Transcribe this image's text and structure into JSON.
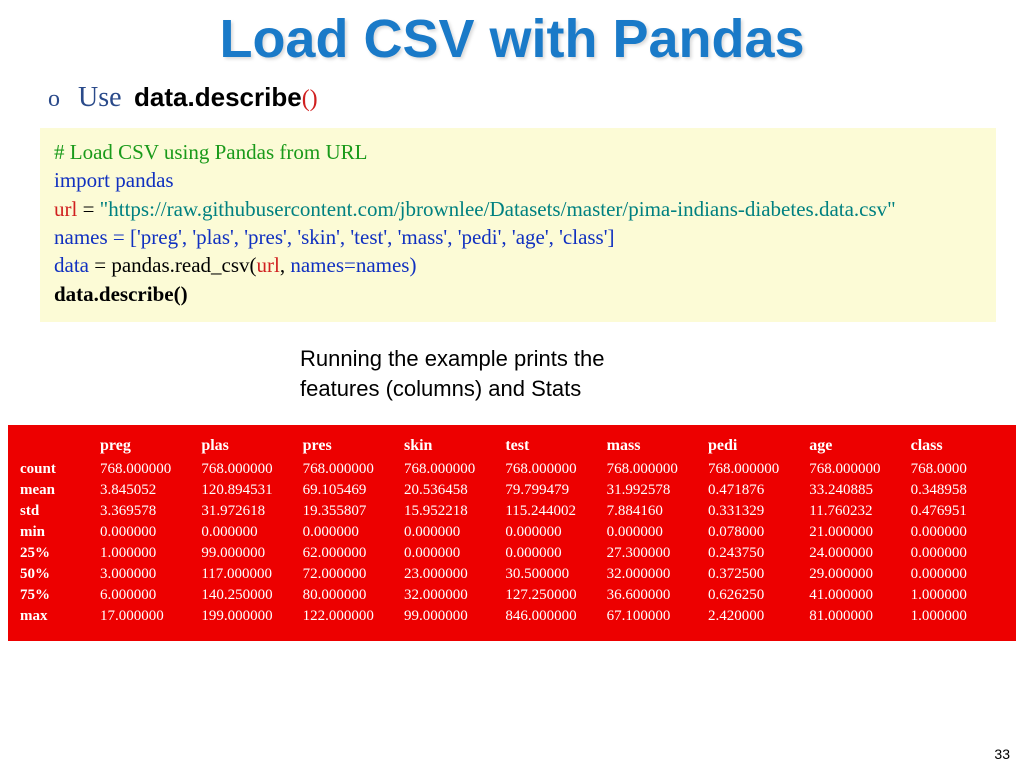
{
  "title": "Load CSV with Pandas",
  "bullet": {
    "marker": "o",
    "use": "Use",
    "code": "data.describe",
    "parens": "()"
  },
  "code": {
    "comment": "# Load CSV using Pandas from URL",
    "import_kw": "import",
    "import_mod": "pandas",
    "url_var": "url",
    "eq": " = ",
    "url_val": "\"https://raw.githubusercontent.com/jbrownlee/Datasets/master/pima-indians-diabetes.data.csv\"",
    "names_var": "names",
    "names_val": " = ['preg', 'plas', 'pres', 'skin', 'test', 'mass', 'pedi', 'age', 'class']",
    "data_var": "data",
    "read_call": " = pandas.read_csv(",
    "url_arg": "url",
    "comma_sp": ", ",
    "names_arg": "names=names)",
    "describe": "data.describe()"
  },
  "caption_l1": "Running the example prints the",
  "caption_l2": "features (columns) and Stats",
  "stats": {
    "columns": [
      "preg",
      "plas",
      "pres",
      "skin",
      "test",
      "mass",
      "pedi",
      "age",
      "class"
    ],
    "row_labels": [
      "count",
      "mean",
      "std",
      "min",
      "25%",
      "50%",
      "75%",
      "max"
    ],
    "rows": [
      [
        "768.000000",
        "768.000000",
        "768.000000",
        "768.000000",
        "768.000000",
        "768.000000",
        "768.000000",
        "768.000000",
        "768.0000"
      ],
      [
        "3.845052",
        "120.894531",
        "69.105469",
        "20.536458",
        "79.799479",
        "31.992578",
        "0.471876",
        "33.240885",
        "0.348958"
      ],
      [
        "3.369578",
        "31.972618",
        "19.355807",
        "15.952218",
        "115.244002",
        "7.884160",
        "0.331329",
        "11.760232",
        "0.476951"
      ],
      [
        "0.000000",
        "0.000000",
        "0.000000",
        "0.000000",
        "0.000000",
        "0.000000",
        "0.078000",
        "21.000000",
        "0.000000"
      ],
      [
        "1.000000",
        "99.000000",
        "62.000000",
        "0.000000",
        "0.000000",
        "27.300000",
        "0.243750",
        "24.000000",
        "0.000000"
      ],
      [
        "3.000000",
        "117.000000",
        "72.000000",
        "23.000000",
        "30.500000",
        "32.000000",
        "0.372500",
        "29.000000",
        "0.000000"
      ],
      [
        "6.000000",
        "140.250000",
        "80.000000",
        "32.000000",
        "127.250000",
        "36.600000",
        "0.626250",
        "41.000000",
        "1.000000"
      ],
      [
        "17.000000",
        "199.000000",
        "122.000000",
        "99.000000",
        "846.000000",
        "67.100000",
        "2.420000",
        "81.000000",
        "1.000000"
      ]
    ]
  },
  "page_number": "33"
}
